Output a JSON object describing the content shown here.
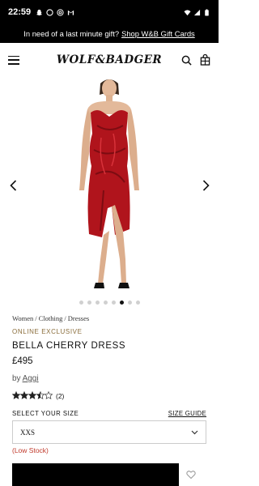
{
  "status_bar": {
    "time": "22:59",
    "left_icons": [
      "snapchat-icon",
      "moon-icon",
      "at-icon",
      "gmail-icon"
    ],
    "right_icons": [
      "wifi-icon",
      "signal-icon",
      "battery-icon"
    ]
  },
  "promo": {
    "text": "In need of a last minute gift?",
    "link": "Shop W&B Gift Cards"
  },
  "header": {
    "logo": "WOLF&BADGER"
  },
  "gallery": {
    "image_count": 8,
    "active_index": 5
  },
  "product": {
    "breadcrumb": [
      "Women",
      "Clothing",
      "Dresses"
    ],
    "badge": "ONLINE EXCLUSIVE",
    "title": "BELLA CHERRY DRESS",
    "price": "£495",
    "by_label": "by",
    "designer": "Aggi",
    "rating": 3.5,
    "review_count": "(2)"
  },
  "size": {
    "label": "SELECT YOUR SIZE",
    "guide": "SIZE GUIDE",
    "selected": "XXS",
    "stock_note": "(Low Stock)"
  },
  "colors": {
    "dress": "#b0141c",
    "accent_gold": "#8a6d3b",
    "low_stock": "#c0392b"
  }
}
